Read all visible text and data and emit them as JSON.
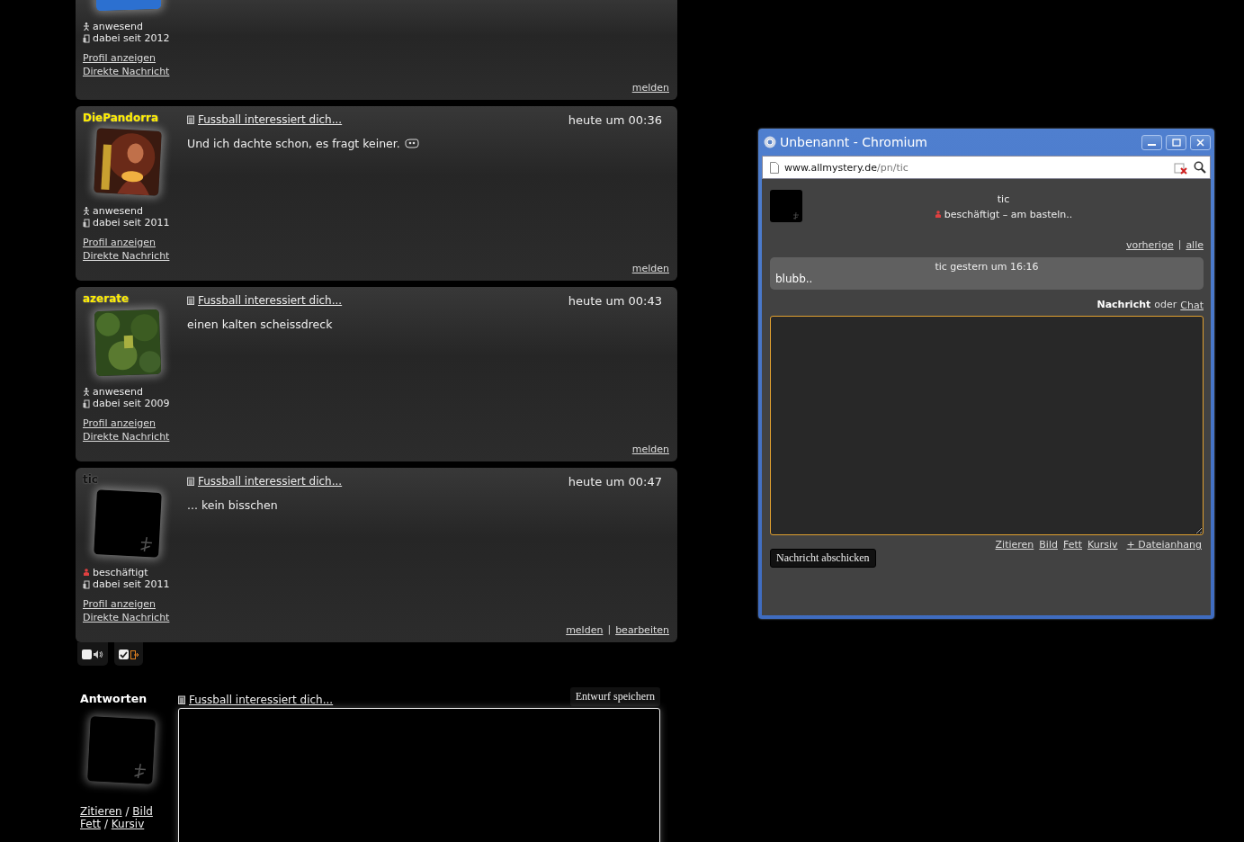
{
  "posts": [
    {
      "kind": "partial",
      "avatar": {
        "kind": "picture"
      },
      "status": {
        "kind": "present",
        "text": "anwesend"
      },
      "member_since": "dabei seit 2012",
      "links": [
        "Profil anzeigen",
        "Direkte Nachricht"
      ],
      "actions": [
        "melden"
      ]
    },
    {
      "kind": "full",
      "username": "DiePandorra",
      "color": "#ffee00",
      "avatar": {
        "kind": "picture"
      },
      "status": {
        "kind": "present",
        "text": "anwesend"
      },
      "member_since": "dabei seit 2011",
      "links": [
        "Profil anzeigen",
        "Direkte Nachricht"
      ],
      "title": "Fussball interessiert dich...",
      "time": "heute um 00:36",
      "body": "Und ich dachte schon, es fragt keiner.",
      "emoticon": true,
      "actions": [
        "melden"
      ]
    },
    {
      "kind": "full",
      "username": "azerate",
      "color": "#ffee00",
      "avatar": {
        "kind": "picture"
      },
      "status": {
        "kind": "present",
        "text": "anwesend"
      },
      "member_since": "dabei seit 2009",
      "links": [
        "Profil anzeigen",
        "Direkte Nachricht"
      ],
      "title": "Fussball interessiert dich...",
      "time": "heute um 00:43",
      "body": "einen kalten scheissdreck",
      "emoticon": false,
      "actions": [
        "melden"
      ]
    },
    {
      "kind": "full",
      "username": "tic",
      "color": "#111111",
      "avatar": {
        "kind": "picture"
      },
      "status": {
        "kind": "busy",
        "text": "beschäftigt"
      },
      "member_since": "dabei seit 2011",
      "links": [
        "Profil anzeigen",
        "Direkte Nachricht"
      ],
      "title": "Fussball interessiert dich...",
      "time": "heute um 00:47",
      "body": "... kein bisschen",
      "emoticon": false,
      "actions": [
        "melden",
        "bearbeiten"
      ],
      "action_separator": "|"
    }
  ],
  "toggles": [
    {
      "kind": "sound",
      "checked": false
    },
    {
      "kind": "exit",
      "checked": true
    }
  ],
  "reply": {
    "heading": "Antworten",
    "avatar": {
      "kind": "picture"
    },
    "format_links": [
      [
        "Zitieren",
        "Bild"
      ],
      [
        "Fett",
        "Kursiv"
      ]
    ],
    "link_separators": [
      "/",
      "/"
    ],
    "title": "Fussball interessiert dich...",
    "save_button": "Entwurf speichern"
  },
  "popup": {
    "title": "Unbenannt - Chromium",
    "url_host": "www.allmystery.de",
    "url_path": "/pn/tic",
    "user": "tic",
    "status": {
      "kind": "busy",
      "text": "beschäftigt – am basteln.."
    },
    "nav_links": [
      "vorherige",
      "alle"
    ],
    "nav_separator": "|",
    "messages": [
      {
        "header": "tic gestern um 16:16",
        "text": "blubb.."
      }
    ],
    "mode": {
      "current": "Nachricht",
      "or": "oder",
      "other": "Chat"
    },
    "format_links": [
      "Zitieren",
      "Bild",
      "Fett",
      "Kursiv",
      "+ Dateianhang"
    ],
    "send_button": "Nachricht abschicken"
  }
}
